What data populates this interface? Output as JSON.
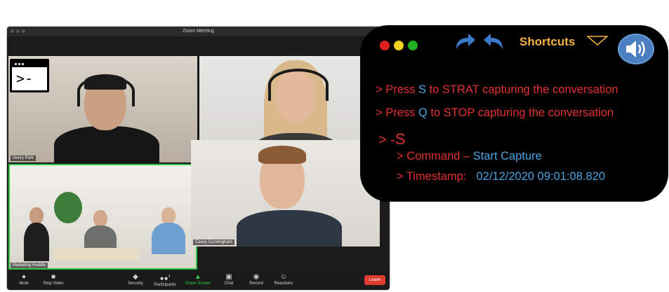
{
  "zoom": {
    "window_title": "Zoom Meeting",
    "participants": {
      "p1": "Henry Park",
      "p3": "Marketing Huddle",
      "p4": "Casey Cunningham"
    },
    "toolbar": {
      "mute": "Mute",
      "stop_video": "Stop Video",
      "security": "Security",
      "participants": "Participants",
      "participants_count": "4",
      "share_screen": "Share Screen",
      "chat": "Chat",
      "record": "Record",
      "reactions": "Reactions",
      "leave": "Leave"
    }
  },
  "terminal_icon": {
    "prompt": ">-"
  },
  "panel": {
    "title": "Shortcuts",
    "instructions": [
      {
        "prefix": "> Press ",
        "key": "S",
        "suffix": " to STRAT capturing the conversation"
      },
      {
        "prefix": "> Press ",
        "key": "Q",
        "suffix": " to STOP capturing the conversation"
      }
    ],
    "input": {
      "prompt": "> -",
      "key": "S"
    },
    "command": {
      "label": "> Command – ",
      "value": "Start Capture"
    },
    "timestamp": {
      "label": "> Timestamp:",
      "value": "02/12/2020 09:01:08.820"
    }
  },
  "colors": {
    "panel_bg": "#000000",
    "accent_red": "#e03030",
    "accent_blue": "#4aa3e0",
    "title_orange": "#f5b041",
    "speaker_blue": "#4a7fc1",
    "active_speaker_green": "#35c24a",
    "leave_red": "#e03b2f"
  },
  "icons": [
    "terminal-icon",
    "redo-arrow-icon",
    "undo-arrow-icon",
    "dropdown-triangle-icon",
    "speaker-icon"
  ]
}
